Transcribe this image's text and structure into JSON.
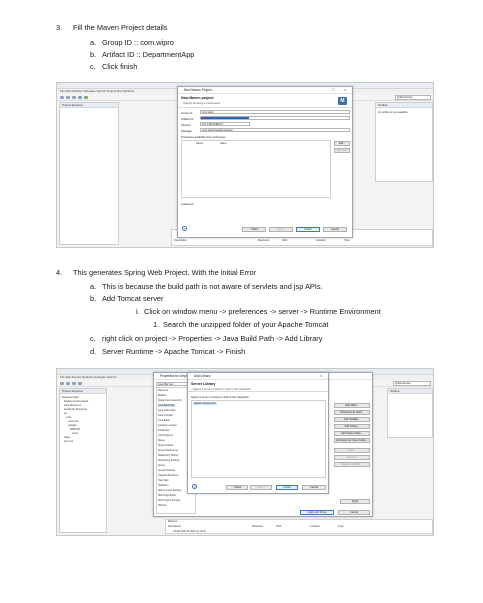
{
  "doc": {
    "step3": {
      "num": "3.",
      "text": "Fill the Maven Project details",
      "items": [
        {
          "mark": "a.",
          "text": "Group ID :: com.wipro"
        },
        {
          "mark": "b.",
          "text": "Artifact ID :: DepartmentApp"
        },
        {
          "mark": "c.",
          "text": "Click finish"
        }
      ]
    },
    "step4": {
      "num": "4.",
      "text": "This generates Spring Web Project. With the initial Error",
      "items": [
        {
          "mark": "a.",
          "text": "This is because the build path is not aware of servlets and jsp APIs."
        },
        {
          "mark": "b.",
          "text": "Add Tomcat server"
        },
        {
          "mark": "i.",
          "text": "Click on window menu -> preferences -> server -> Runtime Environment"
        },
        {
          "mark": "1.",
          "text": "Search the unzipped folder of your Apache Tomcat"
        },
        {
          "mark": "c.",
          "text": "right click on project -> Properties -> Java Build Path -> Add Library"
        },
        {
          "mark": "d.",
          "text": "Server Runtime -> Apache Tomcat -> Finish"
        }
      ]
    }
  },
  "shot1": {
    "menu": "File  Edit  Refactor  Navigate  Search  Project  Run  Window",
    "left_pane": "Project Explorer",
    "right_pane": "Outline",
    "right_msg": "An outline is not available.",
    "quick_access": "Quick Access",
    "dialog": {
      "title": "New Maven Project",
      "heading": "New Maven project",
      "subheading": "Specify Archetype parameters",
      "logo": "M",
      "fields": [
        {
          "label": "Group Id:",
          "value": "com.wipro"
        },
        {
          "label": "Artifact Id:",
          "value": ""
        },
        {
          "label": "Version:",
          "value": "0.0.1-SNAPSHOT"
        },
        {
          "label": "Package:",
          "value": "com.wipro.DepartmentApp"
        }
      ],
      "props_label": "Properties available from archetype:",
      "col_name": "Name",
      "col_value": "Value",
      "add_btn": "Add...",
      "remove_btn": "Remove",
      "advanced": "Advanced",
      "help": "?",
      "buttons": {
        "back": "< Back",
        "next": "Next >",
        "finish": "Finish",
        "cancel": "Cancel"
      },
      "close": "×",
      "minimize": "□"
    },
    "bottom_cols": [
      "Description",
      "Resource",
      "Path",
      "Location",
      "Type"
    ]
  },
  "shot2": {
    "menu": "File  Edit  Source  Refactor  Navigate  Search",
    "left_pane": "Project Explorer",
    "right_pane": "Outline",
    "quick_access": "Quick Access",
    "tree": [
      "DepartmentApp",
      "Deployment Descriptor",
      "Java Resources",
      "JavaScript Resources",
      "src",
      "main",
      "resources",
      "webapp",
      "WEB-INF",
      "views",
      "target",
      "pom.xml"
    ],
    "props_title": "Properties for DepartmentApp",
    "props_filter": "type filter text",
    "props_items": [
      "Resource",
      "Builders",
      "Deployment Assembly",
      "Java Build Path",
      "Java Code Style",
      "Java Compiler",
      "Java Editor",
      "Javadoc Location",
      "JavaScript",
      "JSP Fragment",
      "Maven",
      "Project Facets",
      "Project References",
      "Refactoring History",
      "Run/Debug Settings",
      "Server",
      "Service Policies",
      "Targeted Runtimes",
      "Task Tags",
      "Validation",
      "Web Content Settings",
      "Web Page Editor",
      "Web Project Settings",
      "XDoclet"
    ],
    "dialog": {
      "title": "Add Library",
      "heading": "Server Library",
      "subheading": "Select a server runtime to add to the classpath",
      "list_label": "Select a server runtime to add to the classpath",
      "runtime": "Apache Tomcat v8.5",
      "help": "?",
      "buttons": {
        "back": "< Back",
        "next": "Next >",
        "finish": "Finish",
        "cancel": "Cancel"
      },
      "close": "×"
    },
    "side_buttons": [
      "Add JARs...",
      "Add External JARs...",
      "Add Variable...",
      "Add Library...",
      "Add Class Folder...",
      "Add External Class Folder...",
      "Edit...",
      "Remove",
      "Migrate JAR File..."
    ],
    "apply": "Apply",
    "apply_close": "Apply and Close",
    "cancel": "Cancel",
    "markers": "Markers",
    "bottom_cols": [
      "Description",
      "Resource",
      "Path",
      "Location",
      "Type"
    ],
    "error_row": "Build Path Problem (1 item)"
  }
}
